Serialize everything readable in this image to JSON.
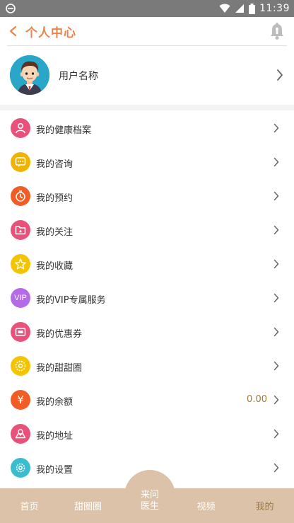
{
  "status_bar": {
    "time": "11:39"
  },
  "header": {
    "title": "个人中心"
  },
  "profile": {
    "username": "用户名称"
  },
  "menu": [
    {
      "label": "我的健康档案",
      "icon": "health-record-icon",
      "color": "#e9507a"
    },
    {
      "label": "我的咨询",
      "icon": "chat-icon",
      "color": "#f0b400"
    },
    {
      "label": "我的预约",
      "icon": "clock-icon",
      "color": "#f25c25"
    },
    {
      "label": "我的关注",
      "icon": "folder-icon",
      "color": "#e9507a"
    },
    {
      "label": "我的收藏",
      "icon": "star-icon",
      "color": "#f5c400"
    },
    {
      "label": "我的VIP专属服务",
      "icon": "vip-icon",
      "color": "#b46be8",
      "icon_text": "VIP"
    },
    {
      "label": "我的优惠券",
      "icon": "coupon-icon",
      "color": "#e9507a"
    },
    {
      "label": "我的甜甜圈",
      "icon": "donut-icon",
      "color": "#f5c400"
    },
    {
      "label": "我的余额",
      "icon": "yen-icon",
      "color": "#f25c25",
      "icon_text": "¥",
      "value": "0.00"
    },
    {
      "label": "我的地址",
      "icon": "map-icon",
      "color": "#e9507a"
    },
    {
      "label": "我的设置",
      "icon": "gear-icon",
      "color": "#3bbdd0"
    }
  ],
  "tabs": [
    {
      "label": "首页"
    },
    {
      "label": "甜圈圈"
    },
    {
      "label": "来问医生"
    },
    {
      "label": "视频"
    },
    {
      "label": "我的",
      "active": true
    }
  ],
  "center_tab": {
    "line1": "来问",
    "line2": "医生"
  },
  "colors": {
    "accent": "#e8844c",
    "tabbar": "#dcc2a8",
    "active_tab": "#a2793b"
  }
}
